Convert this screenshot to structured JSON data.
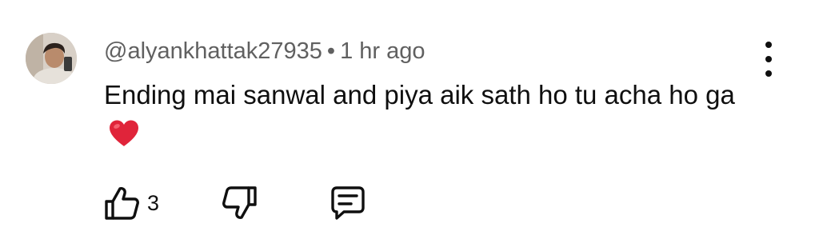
{
  "comment": {
    "author": "@alyankhattak27935",
    "separator": "•",
    "timestamp": "1 hr ago",
    "text": "Ending mai sanwal and piya aik sath ho tu acha ho ga",
    "emoji": "heart-emoji",
    "like_count": "3"
  },
  "icons": {
    "like": "thumbs-up-icon",
    "dislike": "thumbs-down-icon",
    "reply": "reply-comment-icon",
    "more": "more-vertical-icon"
  },
  "colors": {
    "text": "#0f0f0f",
    "meta": "#606060",
    "heart": "#e0243a"
  }
}
